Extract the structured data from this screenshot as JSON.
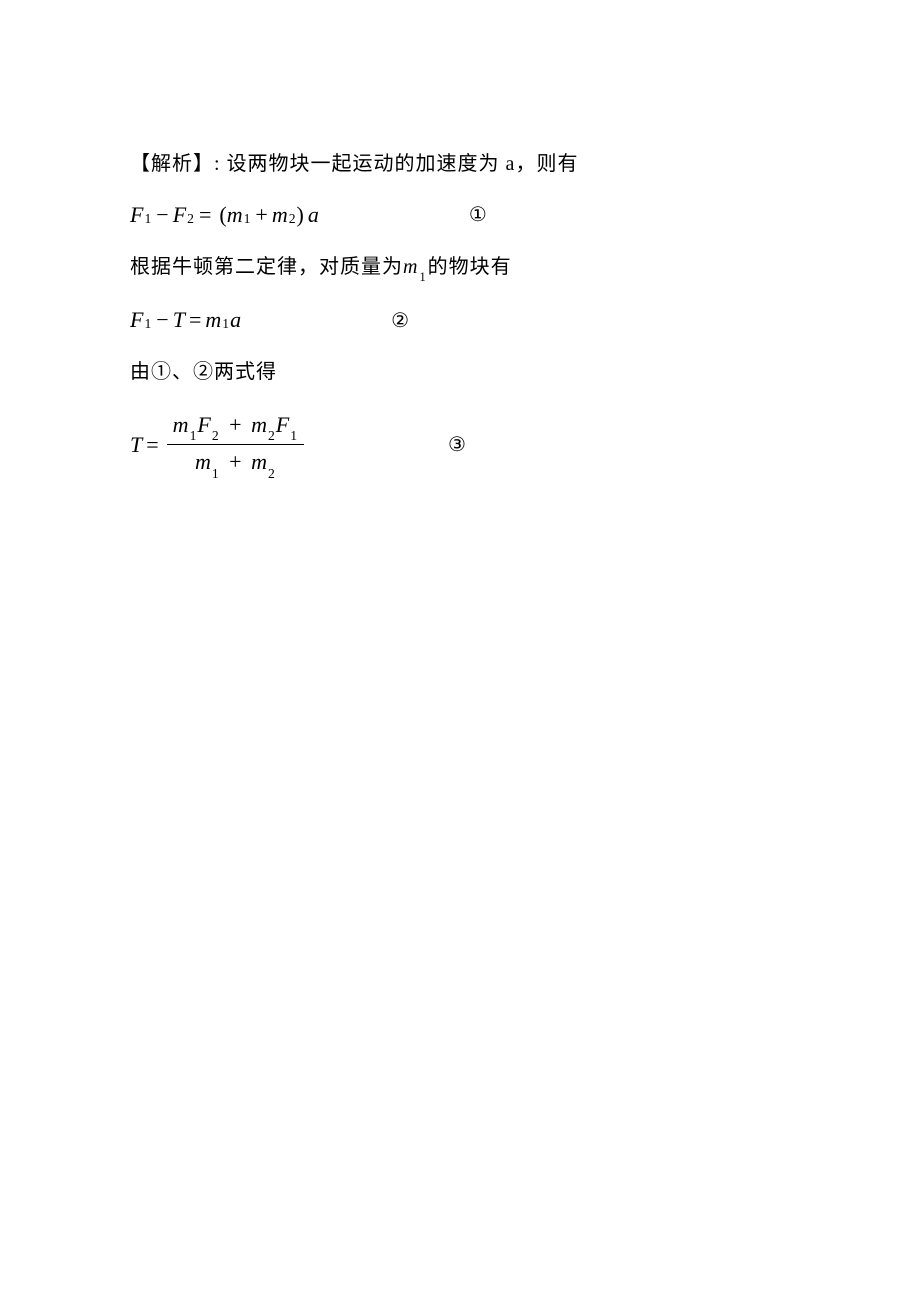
{
  "line1": {
    "prefix": "【解析】:",
    "text": "设两物块一起运动的加速度为 a，则有"
  },
  "eq1": {
    "F1": "F",
    "F1_sub": "1",
    "minus": "−",
    "F2": "F",
    "F2_sub": "2",
    "eq": "=",
    "lparen": "(",
    "m1": "m",
    "m1_sub": "1",
    "plus": "+",
    "m2": "m",
    "m2_sub": "2",
    "rparen": ")",
    "a": "a",
    "label": "①",
    "gap": "150"
  },
  "line2": {
    "prefix": "根据牛顿第二定律，对质量为",
    "m": "m",
    "m_sub": "1",
    "suffix": "的物块有"
  },
  "eq2": {
    "F1": "F",
    "F1_sub": "1",
    "minus": "−",
    "T": "T",
    "eq": "=",
    "m1": "m",
    "m1_sub": "1",
    "a": "a",
    "label": "②",
    "gap": "150"
  },
  "line3": {
    "text": "由①、②两式得"
  },
  "eq3": {
    "T": "T",
    "eq": "=",
    "num_m1": "m",
    "num_m1_sub": "1",
    "num_F2": "F",
    "num_F2_sub": "2",
    "plus_n": "+",
    "num_m2": "m",
    "num_m2_sub": "2",
    "num_F1": "F",
    "num_F1_sub": "1",
    "den_m1": "m",
    "den_m1_sub": "1",
    "plus_d": "+",
    "den_m2": "m",
    "den_m2_sub": "2",
    "label": "③",
    "gap": "140"
  }
}
